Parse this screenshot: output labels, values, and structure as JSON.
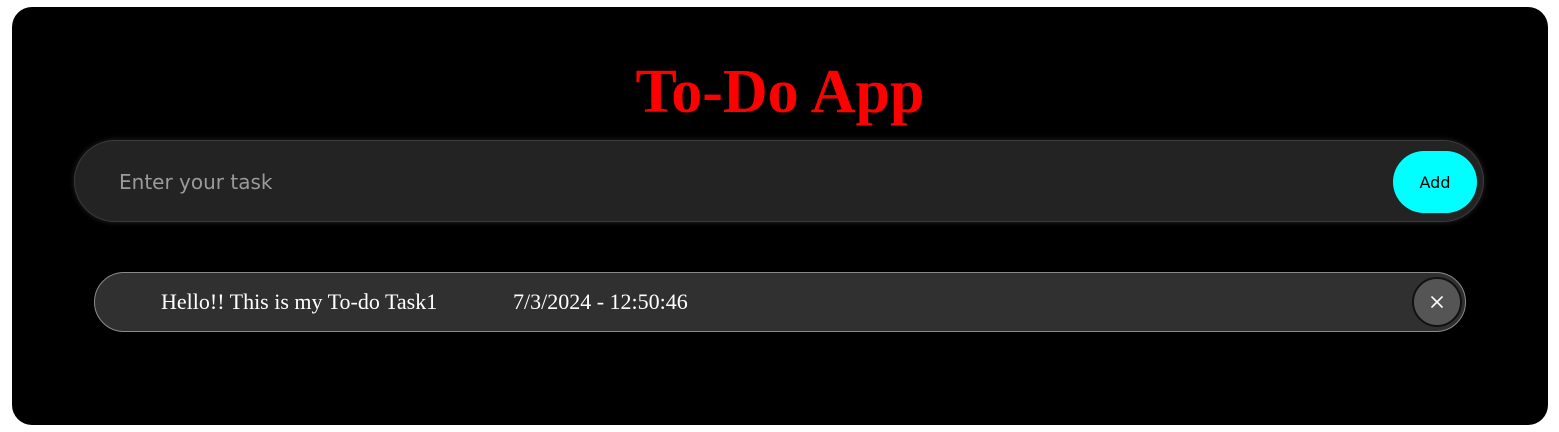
{
  "app": {
    "title": "To-Do App"
  },
  "input": {
    "placeholder": "Enter your task",
    "value": "",
    "add_label": "Add"
  },
  "tasks": [
    {
      "text": "Hello!! This is my To-do Task1",
      "timestamp": "7/3/2024 - 12:50:46",
      "delete_icon": "close-icon"
    }
  ],
  "colors": {
    "background": "#000000",
    "title": "#ff0000",
    "add_button": "#00ffff",
    "input_background": "#232323",
    "task_background": "#303030",
    "delete_button": "#555555"
  }
}
